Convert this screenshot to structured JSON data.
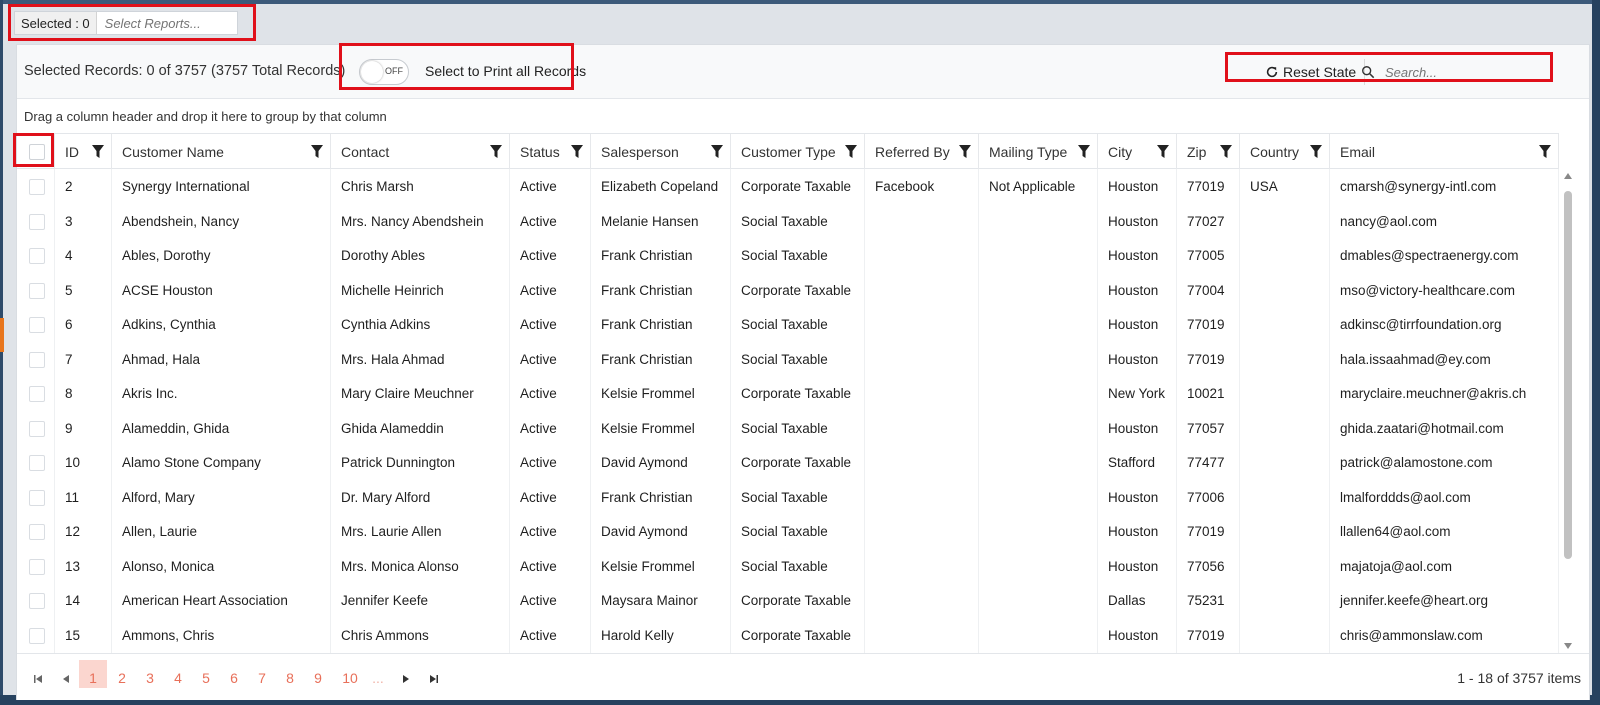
{
  "selector": {
    "count_label": "Selected : 0",
    "placeholder": "Select Reports..."
  },
  "toolbar": {
    "records_text": "Selected Records: 0 of 3757 (3757 Total Records)",
    "toggle_label": "OFF",
    "print_label": "Select to Print all Records",
    "reset_label": "Reset State",
    "search_placeholder": "Search..."
  },
  "group_hint": "Drag a column header and drop it here to group by that column",
  "columns": [
    "ID",
    "Customer Name",
    "Contact",
    "Status",
    "Salesperson",
    "Customer Type",
    "Referred By",
    "Mailing Type",
    "City",
    "Zip",
    "Country",
    "Email"
  ],
  "rows": [
    [
      "2",
      "Synergy International",
      "Chris Marsh",
      "Active",
      "Elizabeth Copeland",
      "Corporate Taxable",
      "Facebook",
      "Not Applicable",
      "Houston",
      "77019",
      "USA",
      "cmarsh@synergy-intl.com"
    ],
    [
      "3",
      "Abendshein, Nancy",
      "Mrs. Nancy Abendshein",
      "Active",
      "Melanie Hansen",
      "Social Taxable",
      "",
      "",
      "Houston",
      "77027",
      "",
      "nancy@aol.com"
    ],
    [
      "4",
      "Ables, Dorothy",
      "Dorothy Ables",
      "Active",
      "Frank Christian",
      "Social Taxable",
      "",
      "",
      "Houston",
      "77005",
      "",
      "dmables@spectraenergy.com"
    ],
    [
      "5",
      "ACSE Houston",
      "Michelle Heinrich",
      "Active",
      "Frank Christian",
      "Corporate Taxable",
      "",
      "",
      "Houston",
      "77004",
      "",
      "mso@victory-healthcare.com"
    ],
    [
      "6",
      "Adkins, Cynthia",
      "Cynthia Adkins",
      "Active",
      "Frank Christian",
      "Social Taxable",
      "",
      "",
      "Houston",
      "77019",
      "",
      "adkinsc@tirrfoundation.org"
    ],
    [
      "7",
      "Ahmad, Hala",
      "Mrs. Hala Ahmad",
      "Active",
      "Frank Christian",
      "Social Taxable",
      "",
      "",
      "Houston",
      "77019",
      "",
      "hala.issaahmad@ey.com"
    ],
    [
      "8",
      "Akris Inc.",
      "Mary Claire Meuchner",
      "Active",
      "Kelsie Frommel",
      "Corporate Taxable",
      "",
      "",
      "New York",
      "10021",
      "",
      "maryclaire.meuchner@akris.ch"
    ],
    [
      "9",
      "Alameddin, Ghida",
      "Ghida Alameddin",
      "Active",
      "Kelsie Frommel",
      "Social Taxable",
      "",
      "",
      "Houston",
      "77057",
      "",
      "ghida.zaatari@hotmail.com"
    ],
    [
      "10",
      "Alamo Stone Company",
      "Patrick Dunnington",
      "Active",
      "David Aymond",
      "Corporate Taxable",
      "",
      "",
      "Stafford",
      "77477",
      "",
      "patrick@alamostone.com"
    ],
    [
      "11",
      "Alford, Mary",
      "Dr. Mary Alford",
      "Active",
      "Frank Christian",
      "Social Taxable",
      "",
      "",
      "Houston",
      "77006",
      "",
      "lmalforddds@aol.com"
    ],
    [
      "12",
      "Allen, Laurie",
      "Mrs. Laurie Allen",
      "Active",
      "David Aymond",
      "Social Taxable",
      "",
      "",
      "Houston",
      "77019",
      "",
      "llallen64@aol.com"
    ],
    [
      "13",
      "Alonso, Monica",
      "Mrs. Monica Alonso",
      "Active",
      "Kelsie Frommel",
      "Social Taxable",
      "",
      "",
      "Houston",
      "77056",
      "",
      "majatoja@aol.com"
    ],
    [
      "14",
      "American Heart Association",
      "Jennifer Keefe",
      "Active",
      "Maysara Mainor",
      "Corporate Taxable",
      "",
      "",
      "Dallas",
      "75231",
      "",
      "jennifer.keefe@heart.org"
    ],
    [
      "15",
      "Ammons, Chris",
      "Chris Ammons",
      "Active",
      "Harold Kelly",
      "Corporate Taxable",
      "",
      "",
      "Houston",
      "77019",
      "",
      "chris@ammonslaw.com"
    ]
  ],
  "pager": {
    "pages": [
      "1",
      "2",
      "3",
      "4",
      "5",
      "6",
      "7",
      "8",
      "9",
      "10",
      "..."
    ],
    "active_page": "1",
    "items_text": "1 - 18 of 3757 items"
  },
  "colors": {
    "highlight": "#e0101a",
    "pager_accent": "#e8705a"
  }
}
